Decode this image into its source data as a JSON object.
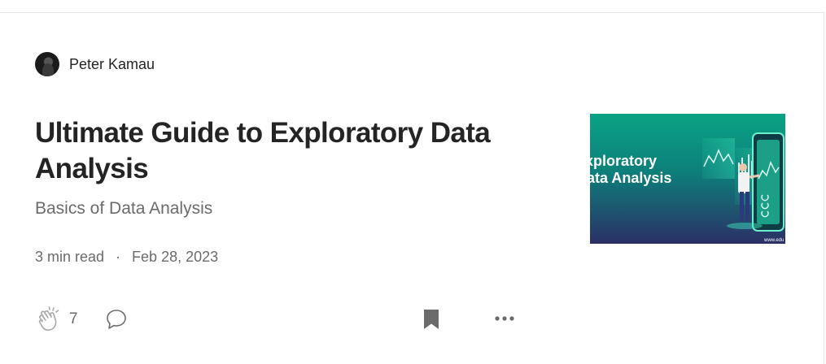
{
  "author": {
    "name": "Peter Kamau"
  },
  "article": {
    "title": "Ultimate Guide to Exploratory Data Analysis",
    "subtitle": "Basics of Data Analysis",
    "read_time": "3 min read",
    "separator": "·",
    "date": "Feb 28, 2023",
    "thumbnail": {
      "line1": "xploratory",
      "line2": "ata Analysis",
      "watermark": "www.edu"
    }
  },
  "actions": {
    "clap_count": "7",
    "icons": [
      "clap-icon",
      "comment-icon",
      "bookmark-icon",
      "more-icon"
    ]
  },
  "colors": {
    "text": "#242424",
    "muted": "#6b6b6b",
    "thumb_teal": "#0a9b82",
    "thumb_navy": "#2a2f63"
  }
}
